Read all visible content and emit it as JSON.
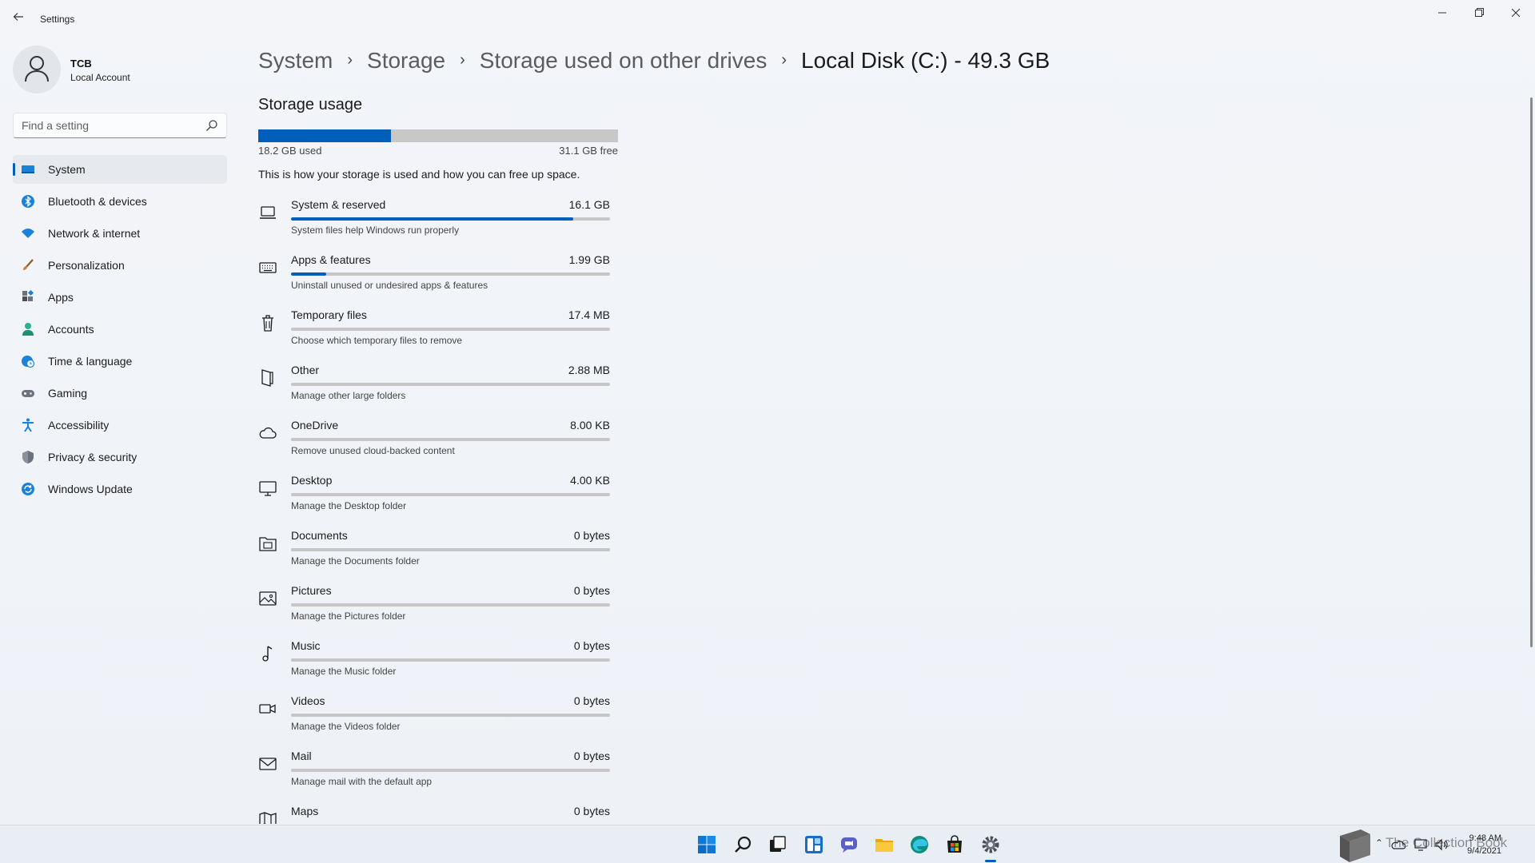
{
  "window": {
    "title": "Settings",
    "back_icon": "back-arrow-icon",
    "controls": [
      "minimize-icon",
      "restore-icon",
      "close-icon"
    ]
  },
  "profile": {
    "name": "TCB",
    "account_type": "Local Account"
  },
  "search": {
    "placeholder": "Find a setting"
  },
  "nav": {
    "items": [
      {
        "label": "System",
        "icon": "system-icon",
        "active": true
      },
      {
        "label": "Bluetooth & devices",
        "icon": "bluetooth-icon"
      },
      {
        "label": "Network & internet",
        "icon": "wifi-icon"
      },
      {
        "label": "Personalization",
        "icon": "brush-icon"
      },
      {
        "label": "Apps",
        "icon": "apps-icon"
      },
      {
        "label": "Accounts",
        "icon": "accounts-icon"
      },
      {
        "label": "Time & language",
        "icon": "globe-clock-icon"
      },
      {
        "label": "Gaming",
        "icon": "gamepad-icon"
      },
      {
        "label": "Accessibility",
        "icon": "accessibility-icon"
      },
      {
        "label": "Privacy & security",
        "icon": "shield-icon"
      },
      {
        "label": "Windows Update",
        "icon": "update-icon"
      }
    ]
  },
  "breadcrumb": {
    "items": [
      "System",
      "Storage",
      "Storage used on other drives",
      "Local Disk (C:) - 49.3 GB"
    ]
  },
  "storage": {
    "section_title": "Storage usage",
    "used_label": "18.2 GB used",
    "free_label": "31.1 GB free",
    "used_fraction": 0.369,
    "description": "This is how your storage is used and how you can free up space.",
    "accent_color": "#005fb8",
    "track_color": "#c6c6c6"
  },
  "categories": [
    {
      "name": "System & reserved",
      "size": "16.1 GB",
      "subtitle": "System files help Windows run properly",
      "fraction": 0.885,
      "icon": "laptop-icon"
    },
    {
      "name": "Apps & features",
      "size": "1.99 GB",
      "subtitle": "Uninstall unused or undesired apps & features",
      "fraction": 0.11,
      "icon": "keyboard-icon"
    },
    {
      "name": "Temporary files",
      "size": "17.4 MB",
      "subtitle": "Choose which temporary files to remove",
      "fraction": 0.0,
      "icon": "trash-icon"
    },
    {
      "name": "Other",
      "size": "2.88 MB",
      "subtitle": "Manage other large folders",
      "fraction": 0.0,
      "icon": "folder-other-icon"
    },
    {
      "name": "OneDrive",
      "size": "8.00 KB",
      "subtitle": "Remove unused cloud-backed content",
      "fraction": 0.0,
      "icon": "cloud-icon"
    },
    {
      "name": "Desktop",
      "size": "4.00 KB",
      "subtitle": "Manage the Desktop folder",
      "fraction": 0.0,
      "icon": "monitor-icon"
    },
    {
      "name": "Documents",
      "size": "0 bytes",
      "subtitle": "Manage the Documents folder",
      "fraction": 0.0,
      "icon": "documents-folder-icon"
    },
    {
      "name": "Pictures",
      "size": "0 bytes",
      "subtitle": "Manage the Pictures folder",
      "fraction": 0.0,
      "icon": "picture-icon"
    },
    {
      "name": "Music",
      "size": "0 bytes",
      "subtitle": "Manage the Music folder",
      "fraction": 0.0,
      "icon": "music-note-icon"
    },
    {
      "name": "Videos",
      "size": "0 bytes",
      "subtitle": "Manage the Videos folder",
      "fraction": 0.0,
      "icon": "video-camera-icon"
    },
    {
      "name": "Mail",
      "size": "0 bytes",
      "subtitle": "Manage mail with the default app",
      "fraction": 0.0,
      "icon": "mail-icon"
    },
    {
      "name": "Maps",
      "size": "0 bytes",
      "subtitle": "",
      "fraction": 0.0,
      "icon": "map-icon"
    }
  ],
  "taskbar": {
    "apps": [
      "start-icon",
      "search-icon",
      "task-view-icon",
      "widgets-icon",
      "chat-icon",
      "file-explorer-icon",
      "edge-icon",
      "store-icon",
      "settings-icon"
    ],
    "active_app": "settings-icon",
    "tray": [
      "chevron-up-icon",
      "onedrive-icon",
      "network-icon",
      "volume-icon"
    ],
    "time": "9:48 AM",
    "date": "9/4/2021",
    "watermark": "The Collection Book"
  }
}
